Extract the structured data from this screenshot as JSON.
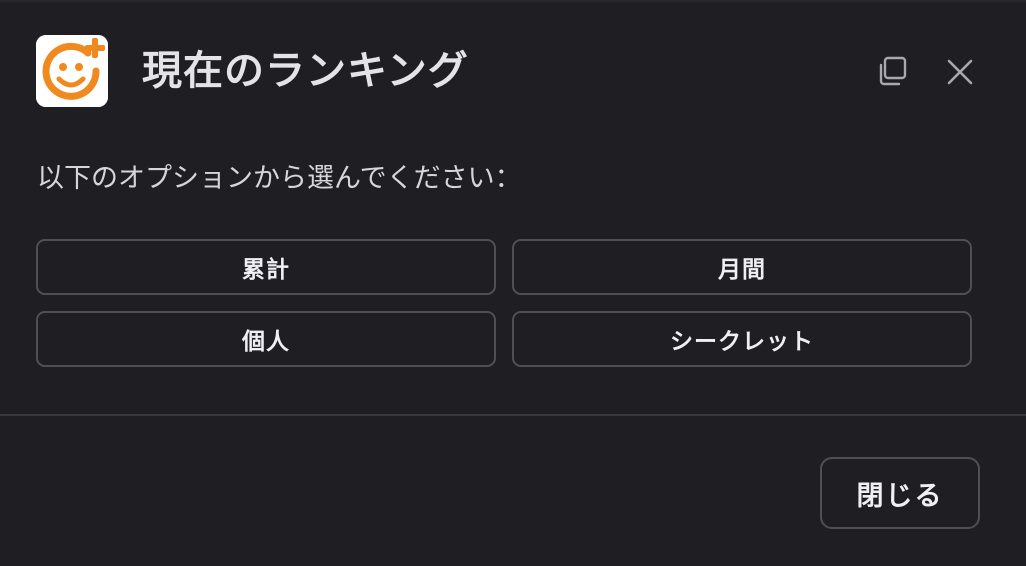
{
  "dialog": {
    "title": "現在のランキング",
    "prompt": "以下のオプションから選んでください：",
    "options": [
      {
        "label": "累計"
      },
      {
        "label": "月間"
      },
      {
        "label": "個人"
      },
      {
        "label": "シークレット"
      }
    ],
    "footer": {
      "close_label": "閉じる"
    },
    "icons": {
      "app": "smiley-plus-icon",
      "copy": "copy-icon",
      "close": "close-icon"
    }
  },
  "colors": {
    "background": "#1f1f23",
    "accent_orange": "#f08a1e",
    "border": "#4f4f55",
    "text": "#f0f0f2"
  }
}
